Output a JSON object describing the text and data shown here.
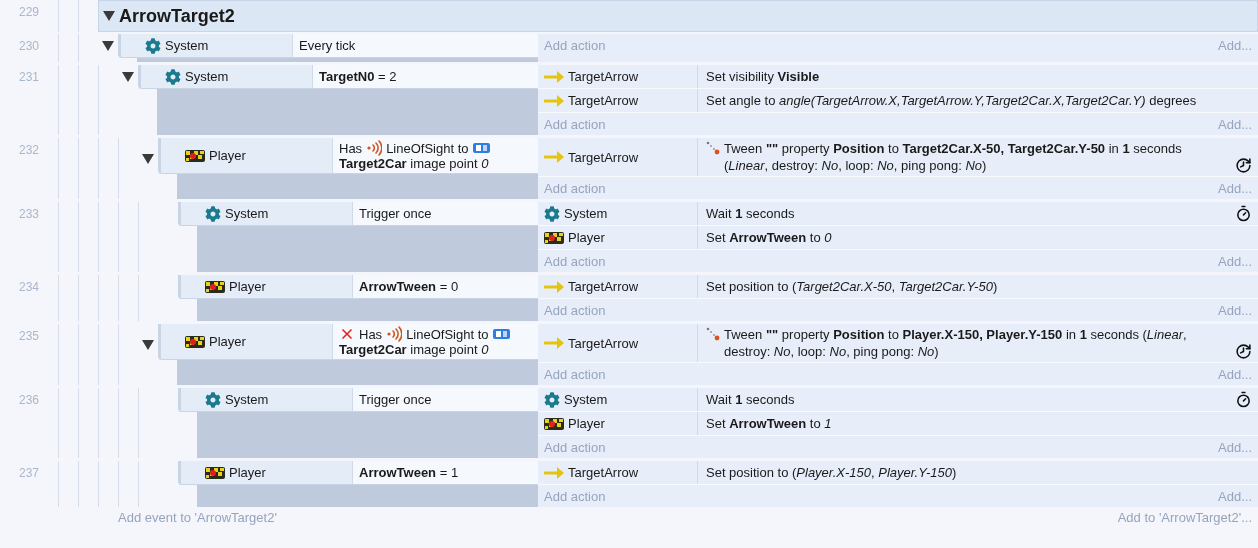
{
  "group": {
    "line": "229",
    "title": "ArrowTarget2",
    "expanded": true,
    "events": [
      {
        "line": "230",
        "expanded": true,
        "conditions": [
          {
            "object": {
              "name": "System",
              "kind": "system"
            },
            "kind": "plain",
            "inverted": false,
            "text": "Every tick"
          }
        ],
        "add_action": "Add action",
        "add_more": "Add...",
        "children": [
          {
            "line": "231",
            "expanded": true,
            "conditions": [
              {
                "object": {
                  "name": "System",
                  "kind": "system"
                },
                "kind": "plain",
                "inverted": false,
                "text": "**TargetN0** = 2"
              }
            ],
            "actions": [
              {
                "object": {
                  "name": "TargetArrow",
                  "kind": "arrow"
                },
                "kind": "plain",
                "text": "Set visibility **Visible**"
              },
              {
                "object": {
                  "name": "TargetArrow",
                  "kind": "arrow"
                },
                "kind": "plain",
                "text": "Set angle to *angle(TargetArrow.X,TargetArrow.Y,Target2Car.X,Target2Car.Y)* degrees"
              }
            ],
            "add_action": "Add action",
            "add_more": "Add...",
            "children": [
              {
                "line": "232",
                "expanded": true,
                "conditions": [
                  {
                    "object": {
                      "name": "Player",
                      "kind": "sprite"
                    },
                    "kind": "line_of_sight",
                    "inverted": false,
                    "prefix": "Has",
                    "behavior": "LineOfSight to",
                    "text": "**Target2Car** image point *0*"
                  }
                ],
                "actions": [
                  {
                    "object": {
                      "name": "TargetArrow",
                      "kind": "arrow"
                    },
                    "kind": "tween",
                    "text": "Tween **\"\"** property **Position** to **Target2Car.X-50, Target2Car.Y-50** in **1** seconds (*Linear*, destroy: *No*, loop: *No*, ping pong: *No*)"
                  }
                ],
                "add_action": "Add action",
                "add_more": "Add...",
                "children": [
                  {
                    "line": "233",
                    "conditions": [
                      {
                        "object": {
                          "name": "System",
                          "kind": "system"
                        },
                        "kind": "plain",
                        "inverted": false,
                        "text": "Trigger once"
                      }
                    ],
                    "actions": [
                      {
                        "object": {
                          "name": "System",
                          "kind": "system"
                        },
                        "kind": "wait",
                        "text": "Wait **1** seconds"
                      },
                      {
                        "object": {
                          "name": "Player",
                          "kind": "sprite"
                        },
                        "kind": "plain",
                        "text": "Set **ArrowTween** to *0*"
                      }
                    ],
                    "add_action": "Add action",
                    "add_more": "Add..."
                  },
                  {
                    "line": "234",
                    "conditions": [
                      {
                        "object": {
                          "name": "Player",
                          "kind": "sprite"
                        },
                        "kind": "plain",
                        "inverted": false,
                        "text": "**ArrowTween** = 0"
                      }
                    ],
                    "actions": [
                      {
                        "object": {
                          "name": "TargetArrow",
                          "kind": "arrow"
                        },
                        "kind": "plain",
                        "text": "Set position to (*Target2Car.X-50*, *Target2Car.Y-50*)"
                      }
                    ],
                    "add_action": "Add action",
                    "add_more": "Add..."
                  }
                ]
              },
              {
                "line": "235",
                "expanded": true,
                "conditions": [
                  {
                    "object": {
                      "name": "Player",
                      "kind": "sprite"
                    },
                    "kind": "line_of_sight",
                    "inverted": true,
                    "prefix": "Has",
                    "behavior": "LineOfSight to",
                    "text": "**Target2Car** image point *0*"
                  }
                ],
                "actions": [
                  {
                    "object": {
                      "name": "TargetArrow",
                      "kind": "arrow"
                    },
                    "kind": "tween",
                    "text": "Tween **\"\"** property **Position** to **Player.X-150, Player.Y-150** in **1** seconds (*Linear*, destroy: *No*, loop: *No*, ping pong: *No*)"
                  }
                ],
                "add_action": "Add action",
                "add_more": "Add...",
                "children": [
                  {
                    "line": "236",
                    "conditions": [
                      {
                        "object": {
                          "name": "System",
                          "kind": "system"
                        },
                        "kind": "plain",
                        "inverted": false,
                        "text": "Trigger once"
                      }
                    ],
                    "actions": [
                      {
                        "object": {
                          "name": "System",
                          "kind": "system"
                        },
                        "kind": "wait",
                        "text": "Wait **1** seconds"
                      },
                      {
                        "object": {
                          "name": "Player",
                          "kind": "sprite"
                        },
                        "kind": "plain",
                        "text": "Set **ArrowTween** to *1*"
                      }
                    ],
                    "add_action": "Add action",
                    "add_more": "Add..."
                  },
                  {
                    "line": "237",
                    "conditions": [
                      {
                        "object": {
                          "name": "Player",
                          "kind": "sprite"
                        },
                        "kind": "plain",
                        "inverted": false,
                        "text": "**ArrowTween** = 1"
                      }
                    ],
                    "actions": [
                      {
                        "object": {
                          "name": "TargetArrow",
                          "kind": "arrow"
                        },
                        "kind": "plain",
                        "text": "Set position to (*Player.X-150*, *Player.Y-150*)"
                      }
                    ],
                    "add_action": "Add action",
                    "add_more": "Add..."
                  }
                ]
              }
            ]
          }
        ]
      }
    ],
    "add_event": "Add event to 'ArrowTarget2'",
    "add_to": "Add to 'ArrowTarget2'..."
  }
}
